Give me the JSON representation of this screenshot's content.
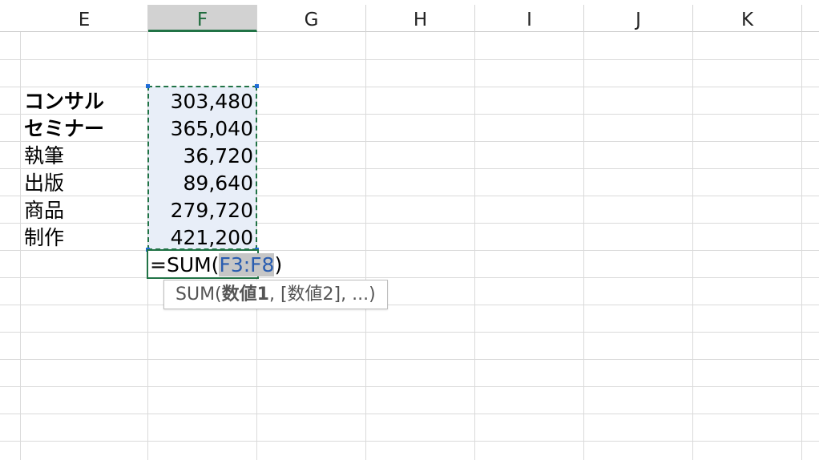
{
  "columns": [
    {
      "letter": "E"
    },
    {
      "letter": "F"
    },
    {
      "letter": "G"
    },
    {
      "letter": "H"
    },
    {
      "letter": "I"
    },
    {
      "letter": "J"
    },
    {
      "letter": "K"
    }
  ],
  "rows": [
    {
      "label": "コンサル",
      "value": "303,480"
    },
    {
      "label": "セミナー",
      "value": "365,040"
    },
    {
      "label": "執筆",
      "value": "36,720"
    },
    {
      "label": "出版",
      "value": "89,640"
    },
    {
      "label": "商品",
      "value": "279,720"
    },
    {
      "label": "制作",
      "value": "421,200"
    }
  ],
  "formula": {
    "prefix": "=SUM(",
    "range_ref": "F3:F8",
    "suffix": ")"
  },
  "tooltip": {
    "func": "SUM(",
    "arg1": "数値1",
    "rest": ", [数値2], ...)"
  },
  "colors": {
    "accent_green": "#217346",
    "ref_blue": "#2a5db0",
    "range_fill": "#e8eef8"
  }
}
